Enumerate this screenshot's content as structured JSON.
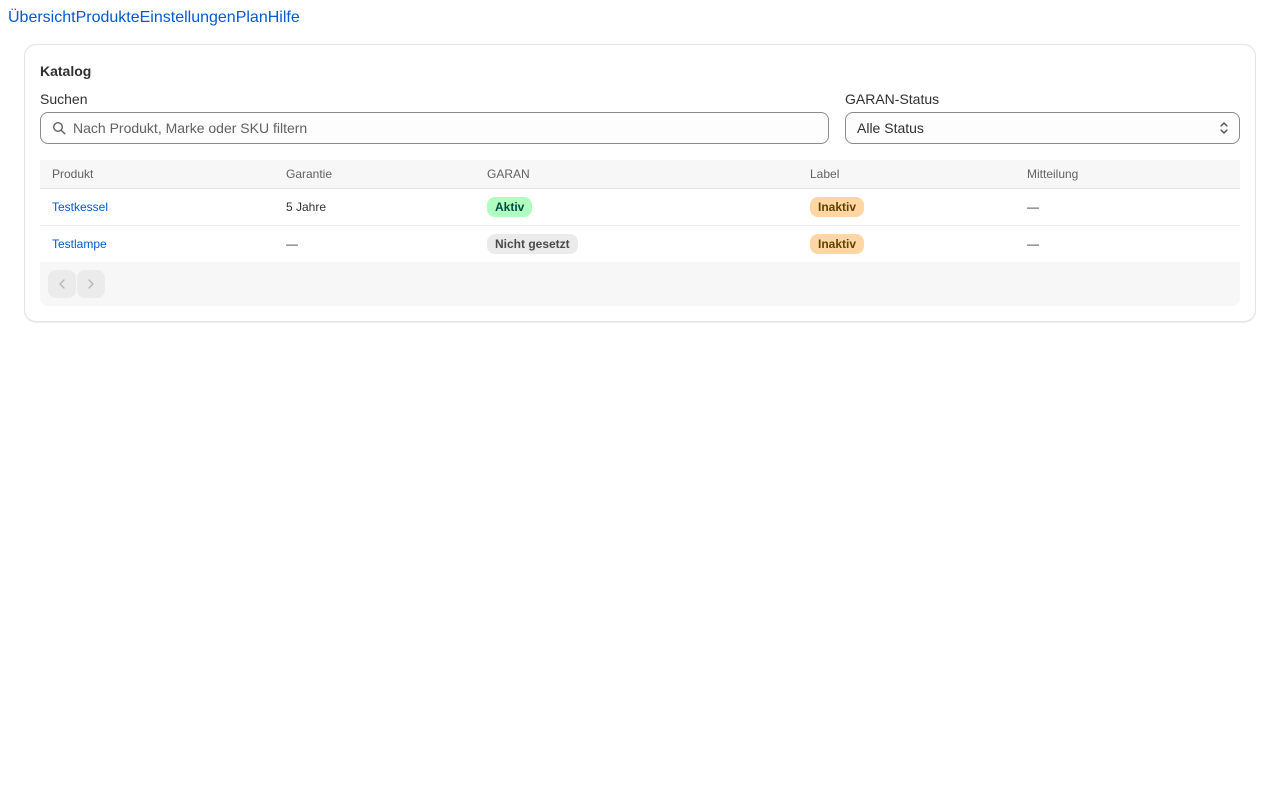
{
  "nav": {
    "items": [
      "Übersicht",
      "Produkte",
      "Einstellungen",
      "Plan",
      "Hilfe"
    ]
  },
  "card": {
    "title": "Katalog"
  },
  "search": {
    "label": "Suchen",
    "placeholder": "Nach Produkt, Marke oder SKU filtern",
    "icon": "search-icon"
  },
  "status_filter": {
    "label": "GARAN-Status",
    "selected": "Alle Status",
    "icon": "select-chevrons-icon"
  },
  "table": {
    "columns": [
      "Produkt",
      "Garantie",
      "GARAN",
      "Label",
      "Mitteilung"
    ],
    "rows": [
      {
        "product": "Testkessel",
        "warranty": "5 Jahre",
        "garan": "Aktiv",
        "label": "Inaktiv",
        "message": "—"
      },
      {
        "product": "Testlampe",
        "warranty": "—",
        "garan": "Nicht gesetzt",
        "label": "Inaktiv",
        "message": "—"
      }
    ]
  },
  "pagination": {
    "prev_icon": "chevron-left-icon",
    "next_icon": "chevron-right-icon"
  },
  "colors": {
    "link": "#005bd3",
    "badge_success_bg": "#affebf",
    "badge_warning_bg": "#ffd6a4",
    "badge_neutral_bg": "#ebebeb"
  }
}
